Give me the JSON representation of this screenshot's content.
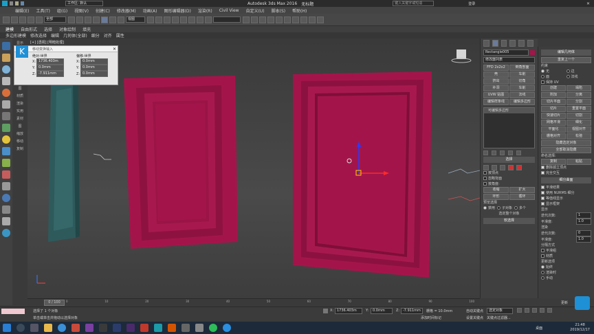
{
  "title": {
    "app_title": "Autodesk 3ds Max 2016",
    "file": "无标题",
    "workspace": "工作区: 默认",
    "search_placeholder": "键入关键字或短语",
    "login": "登录"
  },
  "menu": [
    "编辑(E)",
    "工具(T)",
    "组(G)",
    "视图(V)",
    "创建(C)",
    "修改器(M)",
    "动画(A)",
    "图形编辑器(D)",
    "渲染(R)",
    "Civil View",
    "自定义(U)",
    "脚本(S)",
    "帮助(H)"
  ],
  "toolbar": {
    "selection_filter": "全部",
    "view_mode": "视图"
  },
  "ribbon": {
    "tabs": [
      "建模",
      "自由形式",
      "选择",
      "对象绘制",
      "填充"
    ],
    "sub": [
      "多边形建模",
      "修改选择",
      "编辑",
      "几何体(全部)",
      "细分",
      "对齐",
      "属性"
    ]
  },
  "left_labels": [
    "显示",
    "图",
    "编辑",
    "显示",
    "灯光",
    "相机",
    "图",
    "材质",
    "渲染",
    "实用",
    "素材",
    "图",
    "缩放",
    "移动",
    "复制",
    "",
    "",
    "",
    "",
    "",
    ""
  ],
  "transform_dialog": {
    "title": "移动变换输入",
    "absolute_title": "绝对:世界",
    "offset_title": "偏移:世界",
    "abs": {
      "x": "1736.403m",
      "y": "0.0mm",
      "z": "-7.911mm"
    },
    "off": {
      "x": "0.0mm",
      "y": "0.0mm",
      "z": "0.0mm"
    }
  },
  "viewport": {
    "label": "[+] [透视] [明暗处理]"
  },
  "command_panel": {
    "object_name": "Rectangle005",
    "modifier_list": "修改器列表",
    "buttons": [
      "FFD 2x2x2",
      "倒角剖面",
      "壳",
      "车削",
      "挤出",
      "切角",
      "补洞",
      "车削",
      "UVW 贴图",
      "法线",
      "编辑样条线",
      "编辑多边形"
    ],
    "stack_item": "可编辑多边形",
    "selection_header": "选择",
    "checks": [
      {
        "label": "按顶点",
        "on": false
      },
      {
        "label": "忽略背面",
        "on": false
      },
      {
        "label": "按角度:",
        "on": false
      }
    ],
    "shrink": "收缩",
    "grow": "扩大",
    "ring": "环形",
    "loop": "循环",
    "preview_title": "预览选择",
    "preview_opts": [
      "禁用",
      "子对象",
      "多个"
    ],
    "status_text": "选定整个对象",
    "soft_sel": "软选择"
  },
  "right_panel": {
    "header": "编辑几何体",
    "repeat": "重复上一个",
    "constraints_title": "约束",
    "constraints": [
      "无",
      "边",
      "面",
      "法线"
    ],
    "preserve_uv": "保持 UV",
    "create": "创建",
    "collapse": "塌陷",
    "attach": "附加",
    "detach": "分离",
    "slice_plane": "切片平面",
    "split": "分割",
    "slice": "切片",
    "reset_plane": "重置平面",
    "quickslice": "快速切片",
    "cut": "切割",
    "meshsmooth": "网格平滑",
    "tessellate": "细化",
    "planarize": "平面化",
    "view_align": "视图对齐",
    "grid_align": "栅格对齐",
    "relax": "松弛",
    "hide_sel": "隐藏选定对象",
    "unhide": "全部取消隐藏",
    "named_sel": "命名选择:",
    "copy": "复制",
    "paste": "粘贴",
    "delete_iso": "删除孤立顶点",
    "full_interact": "完全交互",
    "subdiv_header": "细分曲面",
    "smooth_result": "平滑结果",
    "use_nurms": "使用 NURMS 细分",
    "isoline": "等值线显示",
    "show_cage": "显示框架",
    "display_title": "显示",
    "iterations_label": "迭代次数:",
    "iterations": "1",
    "smoothness_label": "平滑度:",
    "smoothness": "1.0",
    "render_title": "渲染",
    "render_iter": "0",
    "render_smooth": "1.0",
    "sep_title": "分隔方式",
    "sep": [
      "平滑组",
      "材质"
    ],
    "update_title": "更新选项",
    "update": [
      "始终",
      "渲染时",
      "手动"
    ],
    "update_btn": "更新"
  },
  "timeline": {
    "frame": "0 / 100",
    "ticks": [
      "0",
      "5",
      "10",
      "15",
      "20",
      "25",
      "30",
      "35",
      "40",
      "45",
      "50",
      "55",
      "60",
      "65",
      "70",
      "75",
      "80",
      "85",
      "90",
      "95",
      "100"
    ]
  },
  "status": {
    "selected": "选择了 1 个对象",
    "hint": "单击或单击并拖动以选择对象",
    "x": "1736.403m",
    "y": "0.0mm",
    "z": "-7.911mm",
    "grid": "栅格 = 10.0mm",
    "autokey": "自动关键点",
    "selected_obj": "选定对象",
    "setkey": "设置关键点",
    "key_filter": "关键点过滤器...",
    "add_tag": "添加时间标记"
  },
  "taskbar": {
    "desktop": "桌面",
    "time": "21:48",
    "date": "2019/12/17"
  },
  "colors": {
    "door_red": "#a3154a",
    "door_teal": "#2e5a5c",
    "accent_blue": "#1e90d6"
  }
}
